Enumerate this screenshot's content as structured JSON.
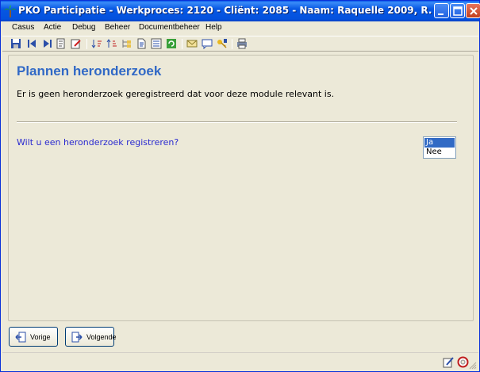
{
  "window": {
    "title": "PKO Participatie - Werkproces: 2120 - Cliënt: 2085 - Naam: Raquelle 2009, R."
  },
  "menubar": {
    "items": [
      {
        "label": "Casus"
      },
      {
        "label": "Actie"
      },
      {
        "label": "Debug"
      },
      {
        "label": "Beheer"
      },
      {
        "label": "Documentbeheer"
      },
      {
        "label": "Help"
      }
    ]
  },
  "toolbar": {
    "icons": [
      "save-icon",
      "first-record-icon",
      "last-record-icon",
      "notes-icon",
      "edit-icon",
      "sort-down-icon",
      "sort-up-icon",
      "tree-icon",
      "document-icon",
      "list-icon",
      "refresh-icon",
      "mail-icon",
      "message-icon",
      "key-icon",
      "print-icon"
    ]
  },
  "page": {
    "heading": "Plannen heronderzoek",
    "message": "Er is geen heronderzoek geregistreerd dat voor deze module relevant is.",
    "question": "Wilt u een heronderzoek registreren?",
    "options": [
      {
        "label": "Ja",
        "selected": true
      },
      {
        "label": "Nee",
        "selected": false
      }
    ]
  },
  "navigation": {
    "previous_label": "Vorige",
    "next_label": "Volgende"
  },
  "colors": {
    "heading": "#3169c6",
    "question": "#2a2ad0",
    "selection": "#316ac5",
    "titlebar": "#0452de"
  }
}
